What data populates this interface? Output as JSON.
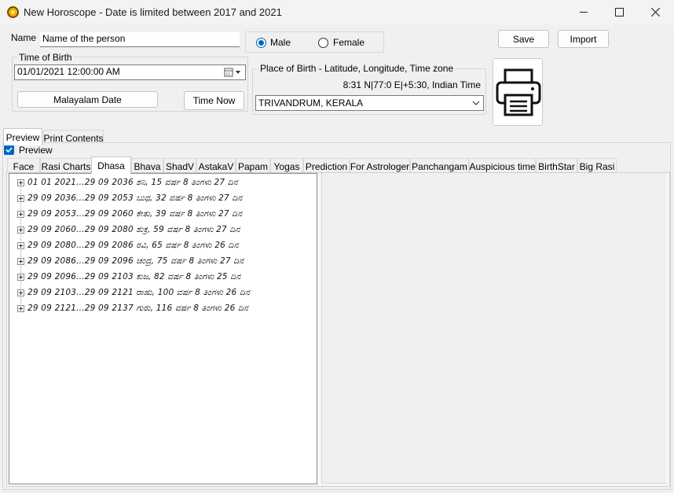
{
  "window": {
    "title": "New Horoscope - Date is limited between 2017 and 2021"
  },
  "form": {
    "name_label": "Name",
    "name_value": "Name of the person",
    "gender_options": [
      "Male",
      "Female"
    ],
    "gender_selected": "Male",
    "save_label": "Save",
    "import_label": "Import",
    "time_of_birth_label": "Time of Birth",
    "time_of_birth_value": "01/01/2021  12:00:00 AM",
    "malayalam_date_label": "Malayalam Date",
    "time_now_label": "Time Now",
    "place_label": "Place of Birth - Latitude, Longitude, Time zone",
    "place_coords": "8:31 N|77:0 E|+5:30, Indian Time",
    "place_value": "TRIVANDRUM, KERALA"
  },
  "outer_tabs": {
    "items": [
      "Preview",
      "Print Contents"
    ],
    "active": "Preview"
  },
  "preview_checkbox": {
    "label": "Preview",
    "checked": true
  },
  "inner_tabs": {
    "items": [
      "Face",
      "Rasi Charts",
      "Dhasa",
      "Bhava",
      "ShadV",
      "AstakaV",
      "Papam",
      "Yogas",
      "Prediction",
      "For Astrologer",
      "Panchangam",
      "Auspicious time",
      "BirthStar",
      "Big Rasi"
    ],
    "active": "Dhasa"
  },
  "dhasa_tree": [
    "01  01  2021...29  09  2036   ಶನಿ, 15 ವರ್ಷ 8 ತಿಂಗಳು 27 ದಿನ",
    "29  09  2036...29  09  2053   ಬುಧ, 32 ವರ್ಷ 8 ತಿಂಗಳು 27 ದಿನ",
    "29  09  2053...29  09  2060   ಕೇತು, 39 ವರ್ಷ 8 ತಿಂಗಳು 27 ದಿನ",
    "29  09  2060...29  09  2080   ಶುಕ್ರ, 59 ವರ್ಷ 8 ತಿಂಗಳು 27 ದಿನ",
    "29  09  2080...29  09  2086   ರವಿ, 65 ವರ್ಷ 8 ತಿಂಗಳು 26 ದಿನ",
    "29  09  2086...29  09  2096   ಚಂದ್ರ, 75 ವರ್ಷ 8 ತಿಂಗಳು 27 ದಿನ",
    "29  09  2096...29  09  2103   ಕುಜ, 82 ವರ್ಷ 8 ತಿಂಗಳು 25 ದಿನ",
    "29  09  2103...29  09  2121   ರಾಹು, 100 ವರ್ಷ 8 ತಿಂಗಳು 26 ದಿನ",
    "29  09  2121...29  09  2137   ಗುರು, 116 ವರ್ಷ 8 ತಿಂಗಳು 26 ದಿನ"
  ],
  "icons": {
    "app": "sun-emblem-icon",
    "print": "printer-icon",
    "calendar": "calendar-icon"
  },
  "colors": {
    "accent": "#0067c0"
  }
}
